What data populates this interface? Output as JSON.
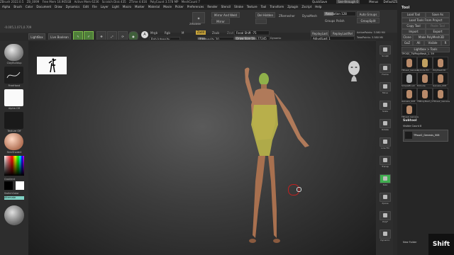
{
  "titlebar": {
    "app": "ZBrush 2022.0.5",
    "doc": "ZB_0099",
    "free_mem": "Free Mem 16.965GB",
    "active_mem": "Active Mem 6236",
    "scratch": "Scratch Disk 435",
    "ztime": "ZTime 4.616",
    "polycount": "PolyCount 3.578 MP",
    "meshcount": "MeshCount 7",
    "quicksave": "QuickSave",
    "see_through": "See-through 0",
    "menus": "Menus",
    "script": "DefaultZScript"
  },
  "menubar": [
    "Alpha",
    "Brush",
    "Color",
    "Document",
    "Draw",
    "Dynamics",
    "Edit",
    "File",
    "Layer",
    "Light",
    "Macro",
    "Marker",
    "Material",
    "Movie",
    "Picker",
    "Preferences",
    "Render",
    "Stencil",
    "Stroke",
    "Texture",
    "Tool",
    "Transform",
    "Zplugin",
    "Zscript",
    "Help"
  ],
  "coord": "-0.005,1.071,0.709",
  "toolbar": {
    "lightbox": "LightBox",
    "live_boolean": "Live Boolean",
    "edit": "Edit",
    "draw": "Draw",
    "move": "Move",
    "scale": "Scale",
    "rotate": "Rotate",
    "a_label": "A",
    "mrgb": "Mrgb",
    "rgb": "Rgb",
    "m": "M",
    "rgb_intensity": "Rgb Intensity",
    "zadd": "Zadd",
    "zsub": "Zsub",
    "zcut": "Zcut",
    "z_intensity": "Z Intensity 20",
    "focal_shift": "Focal Shift -75",
    "draw_size": "Draw Size 144.77245",
    "dynamic": "Dynamic",
    "zmodeler": "ZModeler",
    "mirror_weld": "Mirror And Weld",
    "mirror": "Mirror",
    "del_hidden": "Del Hidden",
    "zremesher": "ZRemesher",
    "dynamesh": "DynaMesh",
    "resolution": "Resolution 128",
    "groups": "Groups",
    "polish": "Polish",
    "auto_groups": "Auto Groups",
    "group_split": "GroupSplit",
    "replay_last": "ReplayLast",
    "replay_last_rel": "ReplayLastRel",
    "adjust_last": "AdjustLast 1",
    "active_points": "ActivePoints: 3.580 Mil",
    "total_points": "TotalPoints: 3.580 Mil"
  },
  "left_shelf": {
    "brush_label": "ClayBuildup",
    "stroke_label": "FreeHand",
    "alpha_label": "Alpha Off",
    "texture_label": "Texture Off",
    "material_label": "SkinShade4",
    "gradient_label": "Gradient",
    "switch_color_label": "SwitchColor",
    "alternate_label": "Alternate",
    "accent": "#7fd1c4"
  },
  "right_shelf": [
    "Sculpt",
    "Frame",
    "Move",
    "Scale",
    "Rotate",
    "Line Fill",
    "Transp",
    "Solo",
    "Xpose",
    "PolyF",
    "Dynamic"
  ],
  "tool_panel": {
    "title": "Tool",
    "load_tool": "Load Tool",
    "save_as": "Save As",
    "load_from_project": "Load Tools From Project",
    "copy_tool": "Copy Tool",
    "paste_tool": "Paste Tool",
    "import": "Import",
    "export": "Export",
    "clone": "Clone",
    "make_polymesh": "Make PolyMesh3D",
    "goz": "GoZ",
    "all": "All",
    "visible": "Visible",
    "r": "R",
    "lightbox_tools": "Lightbox > Tools",
    "current_tool": "TPOSE_TWPolyMesh_1. 59",
    "thumbs": [
      "TPose2_Genesis",
      "Cylinder3D",
      "PolyMesh3D",
      "SimpleBrush",
      "Extrude",
      "Genesis_008",
      "Genesis_008",
      "TMPolyMesh_1",
      "TPose2_Genesis",
      "TPose2_Genesis"
    ],
    "subtool": "Subtool",
    "visible_count": "Visible Count 8",
    "subtool_item": "TPose2_Genesis_008",
    "new_folder": "New Folder"
  },
  "shift_key": "Shift"
}
